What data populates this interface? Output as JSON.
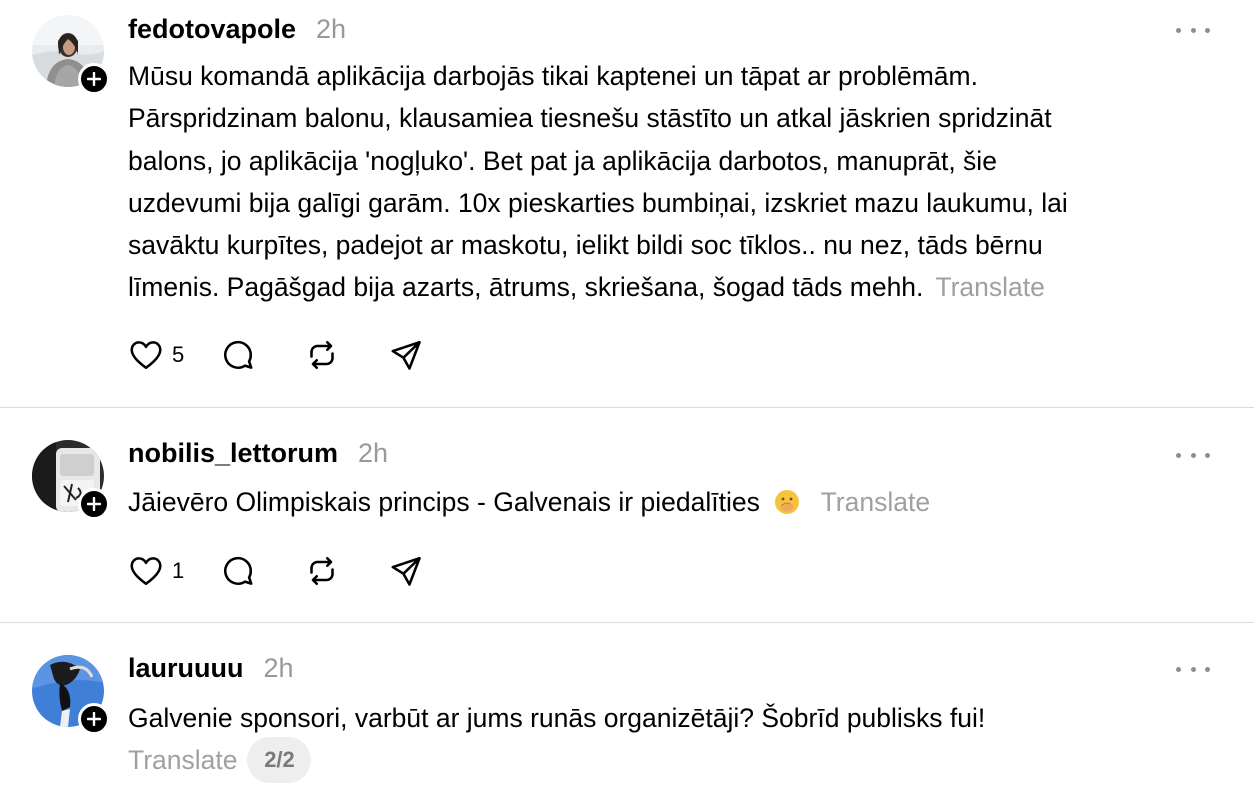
{
  "posts": [
    {
      "username": "fedotovapole",
      "time": "2h",
      "text_lines": [
        "Mūsu komandā aplikācija darbojās tikai kaptenei un tāpat ar problēmām.",
        "Pārspridzinam balonu, klausamiea tiesnešu stāstīto un atkal jāskrien spridzināt",
        "balons, jo aplikācija 'nogļuko'. Bet pat ja aplikācija darbotos, manuprāt, šie",
        "uzdevumi bija galīgi garām. 10x pieskarties bumbiņai, izskriet mazu laukumu, lai",
        "savāktu kurpītes, padejot ar maskotu, ielikt bildi soc tīklos.. nu nez, tāds bērnu",
        "līmenis. Pagāšgad bija azarts, ātrums, skriešana, šogad tāds mehh."
      ],
      "translate": "Translate",
      "likes": "5"
    },
    {
      "username": "nobilis_lettorum",
      "time": "2h",
      "text": "Jāievēro Olimpiskais princips - Galvenais ir piedalīties",
      "emoji": "face-with-hand-over-mouth-emoji",
      "translate": "Translate",
      "likes": "1"
    },
    {
      "username": "lauruuuu",
      "time": "2h",
      "text": "Galvenie sponsori, varbūt ar jums runās organizētāji? Šobrīd publisks fui!",
      "translate": "Translate",
      "page_indicator": "2/2"
    }
  ],
  "colors": {
    "text": "#000000",
    "muted": "#999999",
    "divider": "#dcdcdc",
    "badge": "#000000"
  },
  "icons": {
    "like": "heart-icon",
    "reply": "comment-bubble-icon",
    "repost": "repost-icon",
    "share": "send-icon",
    "more": "more-horizontal-icon",
    "follow": "plus-icon"
  }
}
